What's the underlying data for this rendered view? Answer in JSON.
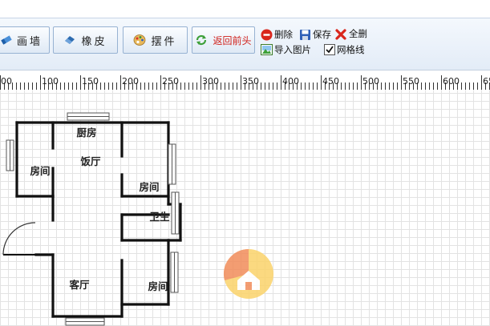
{
  "toolbar": {
    "buttons": [
      {
        "label": "画墙",
        "icon": "wall-pen-icon"
      },
      {
        "label": "橡皮",
        "icon": "eraser-icon"
      },
      {
        "label": "摆件",
        "icon": "palette-icon"
      },
      {
        "label": "返回前头",
        "icon": "refresh-icon"
      }
    ],
    "delete_label": "删除",
    "save_label": "保存",
    "clear_all_label": "全删",
    "import_image_label": "导入图片",
    "grid_label": "网格线",
    "grid_checked": true
  },
  "ruler": {
    "labels": [
      "00",
      "100",
      "150",
      "200",
      "250",
      "300",
      "350",
      "400",
      "450",
      "500",
      "550",
      "600",
      "650"
    ]
  },
  "floorplan": {
    "rooms": [
      {
        "name": "厨房"
      },
      {
        "name": "饭厅"
      },
      {
        "name": "房间"
      },
      {
        "name": "房间"
      },
      {
        "name": "卫生"
      },
      {
        "name": "客厅"
      },
      {
        "name": "房间"
      }
    ]
  },
  "colors": {
    "accent_red": "#d0201a",
    "toolbar_border": "#97b2d2",
    "wall": "#111111",
    "logo_orange": "#f28c5a",
    "logo_yellow": "#fbd36a"
  }
}
